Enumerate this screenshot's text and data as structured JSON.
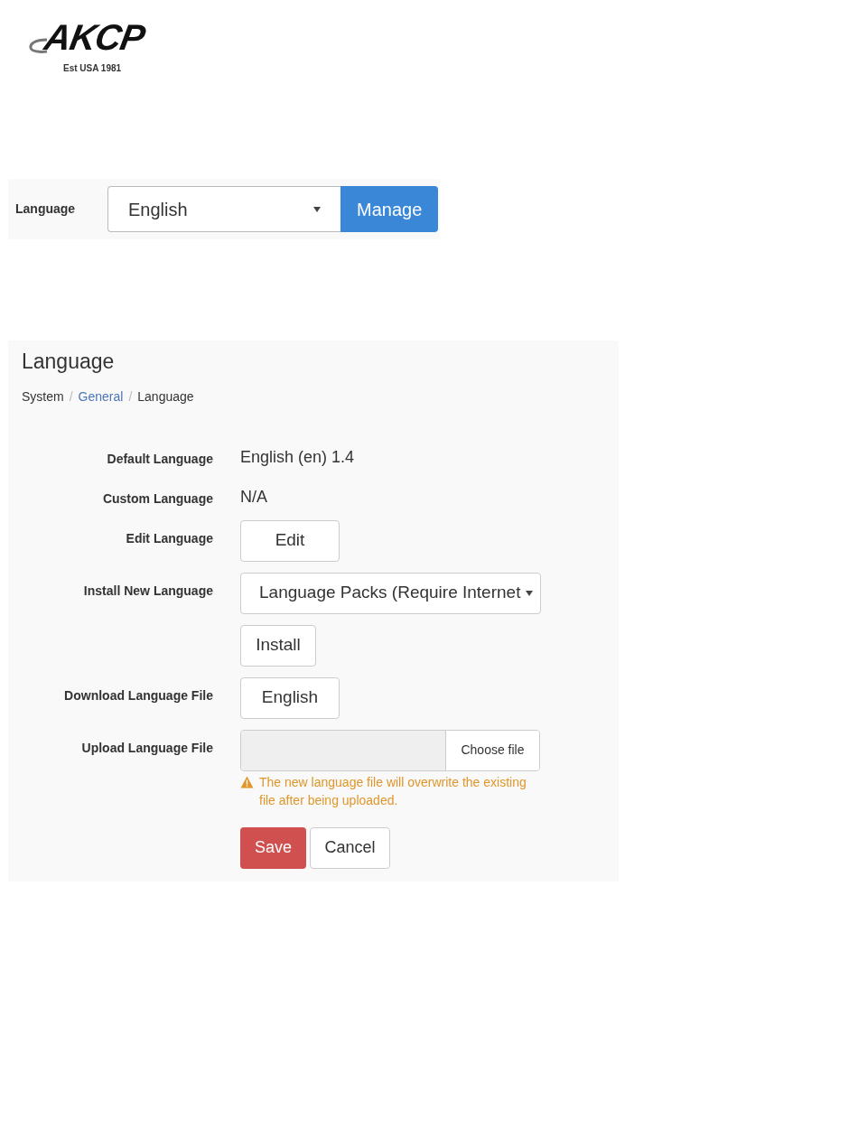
{
  "logo": {
    "brand": "AKCP",
    "tagline": "Est USA 1981"
  },
  "language_bar": {
    "label": "Language",
    "select_value": "English",
    "button": "Manage"
  },
  "panel": {
    "title": "Language",
    "breadcrumb": [
      {
        "label": "System",
        "link": false
      },
      {
        "separator": "/",
        "label": "General",
        "link": true
      },
      {
        "separator": "/",
        "label": "Language",
        "link": false
      }
    ],
    "rows": [
      {
        "kind": "text",
        "label": "Default Language",
        "value": "English (en) 1.4"
      },
      {
        "kind": "text",
        "label": "Custom Language",
        "value": "N/A"
      },
      {
        "kind": "button",
        "label": "Edit Language",
        "value": "Edit",
        "wide": true
      },
      {
        "kind": "select",
        "label": "Install New Language",
        "value": "Language Packs (Require Internet"
      },
      {
        "kind": "button",
        "value": "Install",
        "wide": false
      },
      {
        "kind": "button",
        "label": "Download Language File",
        "value": "English",
        "wide": true
      },
      {
        "kind": "file",
        "label": "Upload Language File",
        "value": "Choose file",
        "warning": "The new language file will overwrite the existing file after being uploaded."
      }
    ],
    "actions": [
      {
        "label": "Save",
        "primary": true
      },
      {
        "label": "Cancel",
        "primary": false
      }
    ]
  }
}
